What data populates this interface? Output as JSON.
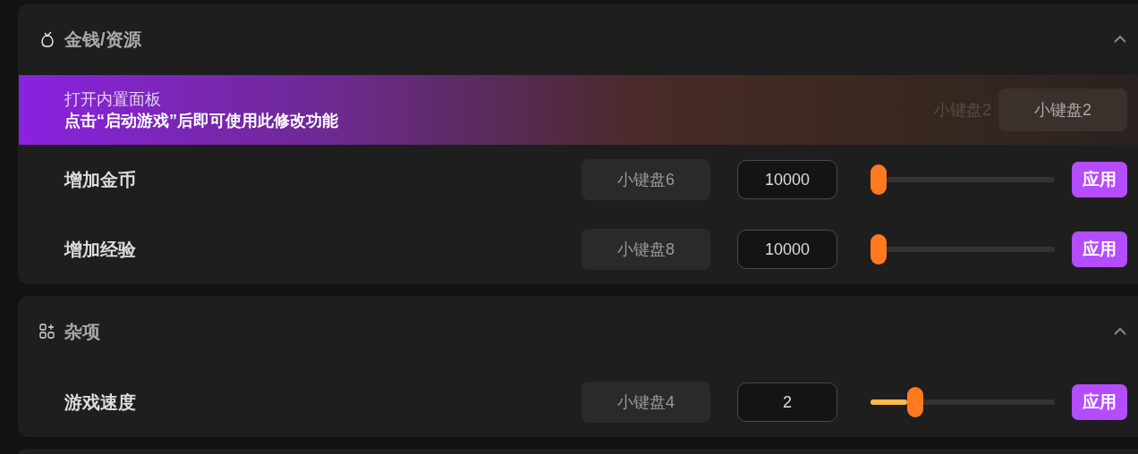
{
  "sections": [
    {
      "title": "金钱/资源",
      "expanded": true,
      "banner": {
        "title": "打开内置面板",
        "subtitle": "点击“启动游戏”后即可使用此修改功能",
        "covered_hotkey": "小键盘2",
        "hotkey": "小键盘2"
      },
      "rows": [
        {
          "label": "增加金币",
          "hotkey": "小键盘6",
          "value": "10000",
          "level": 0,
          "button": "应用"
        },
        {
          "label": "增加经验",
          "hotkey": "小键盘8",
          "value": "10000",
          "level": 0,
          "button": "应用"
        }
      ]
    },
    {
      "title": "杂项",
      "expanded": true,
      "rows": [
        {
          "label": "游戏速度",
          "hotkey": "小键盘4",
          "value": "2",
          "level": 0.2,
          "button": "应用"
        }
      ]
    }
  ]
}
